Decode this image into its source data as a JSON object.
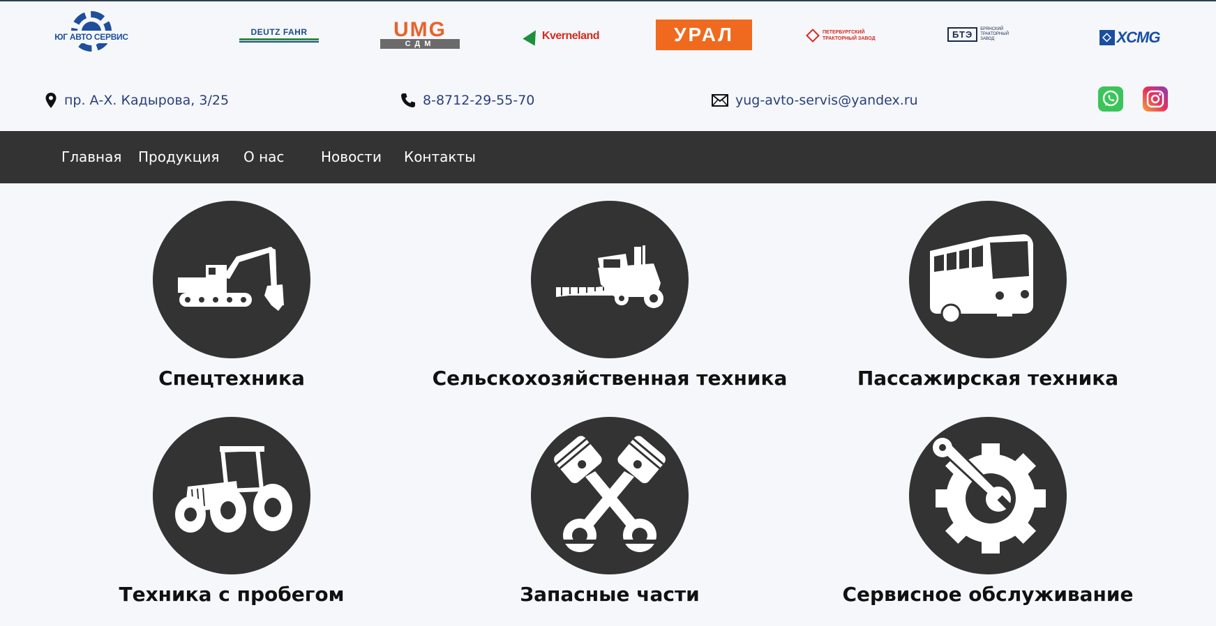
{
  "header": {
    "site_logo": {
      "name": "ЮГ АВТО СЕРВИС"
    },
    "brands": {
      "deutz": "DEUTZ FAHR",
      "umg_top": "UMG",
      "umg_bottom": "СДМ",
      "kverneland": "Kverneland",
      "ural": "УРАЛ",
      "ptz": "ПЕТЕРБУРГСКИЙ ТРАКТОРНЫЙ ЗАВОД",
      "bte_abbr": "БТЭ",
      "bte_full": "БРЯНСКИЙ ТРАКТОРНЫЙ ЗАВОД",
      "xcmg": "XCMG"
    },
    "contacts": {
      "address": "пр. А-Х. Кадырова, 3/25",
      "phone": "8-8712-29-55-70",
      "email": "yug-avto-servis@yandex.ru"
    },
    "social": {
      "whatsapp_icon": "whatsapp-icon",
      "instagram_icon": "instagram-icon"
    }
  },
  "nav": {
    "items": [
      "Главная",
      "Продукция",
      "О нас",
      "Новости",
      "Контакты"
    ]
  },
  "categories": [
    {
      "title": "Спецтехника",
      "icon": "excavator-icon"
    },
    {
      "title": "Сельскохозяйственная техника",
      "icon": "combine-harvester-icon"
    },
    {
      "title": "Пассажирская техника",
      "icon": "bus-icon"
    },
    {
      "title": "Техника с пробегом",
      "icon": "tractor-icon"
    },
    {
      "title": "Запасные части",
      "icon": "pistons-icon"
    },
    {
      "title": "Сервисное обслуживание",
      "icon": "wrench-gear-icon"
    }
  ],
  "colors": {
    "nav_bg": "#333333",
    "circle_bg": "#333333",
    "contact_text": "#2b3f7a",
    "page_bg": "#f5f7fb"
  }
}
